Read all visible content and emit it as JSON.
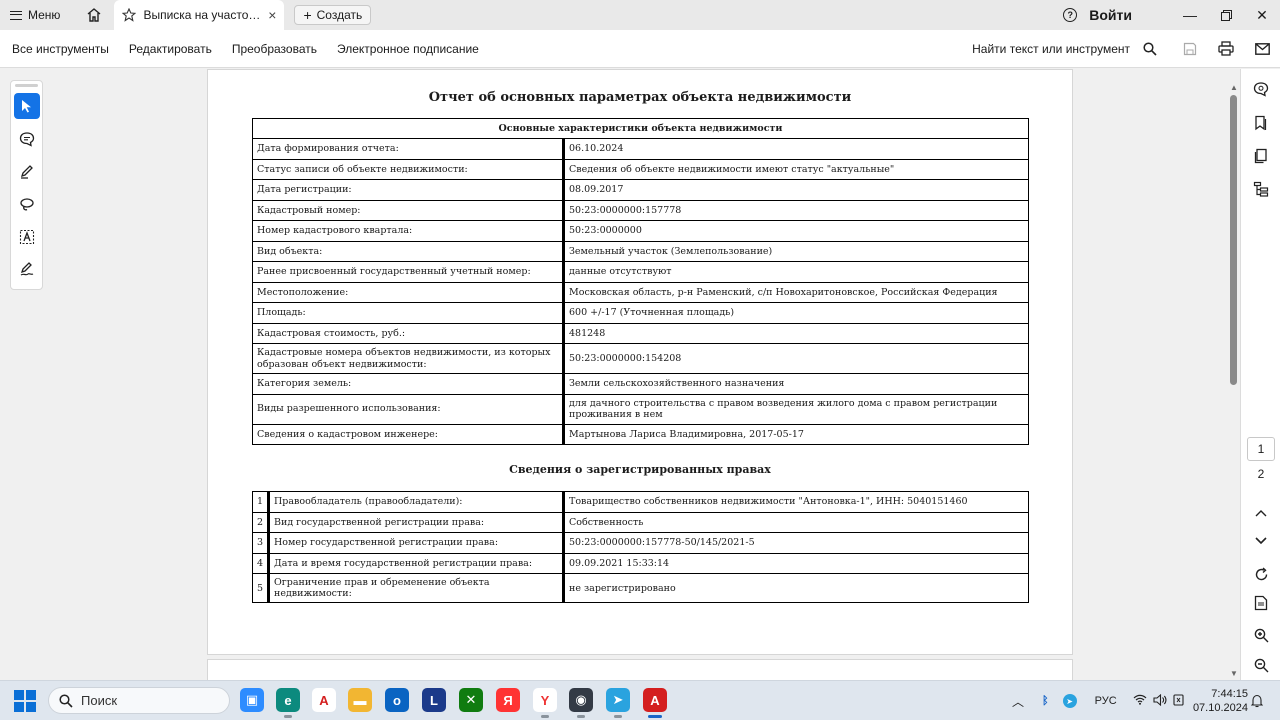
{
  "tabbar": {
    "menu_label": "Меню",
    "tab_title": "Выписка на участок...",
    "tab_close": "×",
    "new_label": "Создать",
    "login_label": "Войти",
    "help_glyph": "?"
  },
  "toolbar": {
    "all_tools": "Все инструменты",
    "edit": "Редактировать",
    "convert": "Преобразовать",
    "esign": "Электронное подписание",
    "find": "Найти текст или инструмент"
  },
  "document": {
    "title": "Отчет об основных параметрах объекта недвижимости",
    "table_header": "Основные характеристики объекта недвижимости",
    "rows": [
      {
        "label": "Дата формирования отчета:",
        "value": "06.10.2024"
      },
      {
        "label": "Статус записи об объекте недвижимости:",
        "value": "Сведения об объекте недвижимости имеют статус \"актуальные\""
      },
      {
        "label": "Дата регистрации:",
        "value": "08.09.2017"
      },
      {
        "label": "Кадастровый номер:",
        "value": "50:23:0000000:157778"
      },
      {
        "label": "Номер кадастрового квартала:",
        "value": "50:23:0000000"
      },
      {
        "label": "Вид объекта:",
        "value": "Земельный участок (Землепользование)"
      },
      {
        "label": "Ранее присвоенный государственный учетный номер:",
        "value": "данные отсутствуют"
      },
      {
        "label": "Местоположение:",
        "value": "Московская область, р-н Раменский, с/п Новохаритоновское, Российская Федерация"
      },
      {
        "label": "Площадь:",
        "value": "600 +/-17 (Уточненная площадь)"
      },
      {
        "label": "Кадастровая стоимость, руб.:",
        "value": "481248"
      },
      {
        "label": "Кадастровые номера объектов недвижимости, из которых образован объект недвижимости:",
        "value": "50:23:0000000:154208"
      },
      {
        "label": "Категория земель:",
        "value": "Земли сельскохозяйственного назначения"
      },
      {
        "label": "Виды разрешенного использования:",
        "value": "для дачного строительства с правом возведения жилого дома с правом регистрации проживания в нем"
      },
      {
        "label": "Сведения о кадастровом инженере:",
        "value": "Мартынова Лариса Владимировна, 2017-05-17"
      }
    ],
    "rights_title": "Сведения о зарегистрированных правах",
    "rights": [
      {
        "num": "1",
        "label": "Правообладатель (правообладатели):",
        "value": "Товарищество собственников недвижимости \"Антоновка-1\", ИНН: 5040151460"
      },
      {
        "num": "2",
        "label": "Вид государственной регистрации права:",
        "value": "Собственность"
      },
      {
        "num": "3",
        "label": "Номер государственной регистрации права:",
        "value": "50:23:0000000:157778-50/145/2021-5"
      },
      {
        "num": "4",
        "label": "Дата и время государственной регистрации права:",
        "value": "09.09.2021 15:33:14"
      },
      {
        "num": "5",
        "label": "Ограничение прав и обременение объекта недвижимости:",
        "value": "не зарегистрировано"
      }
    ]
  },
  "right_panel": {
    "current_page": "1",
    "total_pages": "2"
  },
  "taskbar": {
    "search_placeholder": "Поиск",
    "language": "РУС",
    "time": "7:44:15",
    "date": "07.10.2024",
    "apps": [
      {
        "name": "zoom-app",
        "color": "#2d8cff",
        "glyph": "▣"
      },
      {
        "name": "edge-app",
        "color": "#0c8a7e",
        "glyph": "e"
      },
      {
        "name": "acrobat-reader-app",
        "color": "#ffffff",
        "glyph": "A"
      },
      {
        "name": "file-explorer-app",
        "color": "#f2b632",
        "glyph": "▬"
      },
      {
        "name": "outlook-app",
        "color": "#0a64c2",
        "glyph": "o"
      },
      {
        "name": "lingvo-app",
        "color": "#1b3a8a",
        "glyph": "L"
      },
      {
        "name": "xbox-app",
        "color": "#107c10",
        "glyph": "✕"
      },
      {
        "name": "yandex-app",
        "color": "#f33",
        "glyph": "Я"
      },
      {
        "name": "yandex-browser-app",
        "color": "#ffffff",
        "glyph": "Y"
      },
      {
        "name": "obs-app",
        "color": "#333a45",
        "glyph": "◉"
      },
      {
        "name": "telegram-app",
        "color": "#2aa3df",
        "glyph": "➤"
      },
      {
        "name": "acrobat-app",
        "color": "#d41f1f",
        "glyph": "A"
      }
    ]
  }
}
